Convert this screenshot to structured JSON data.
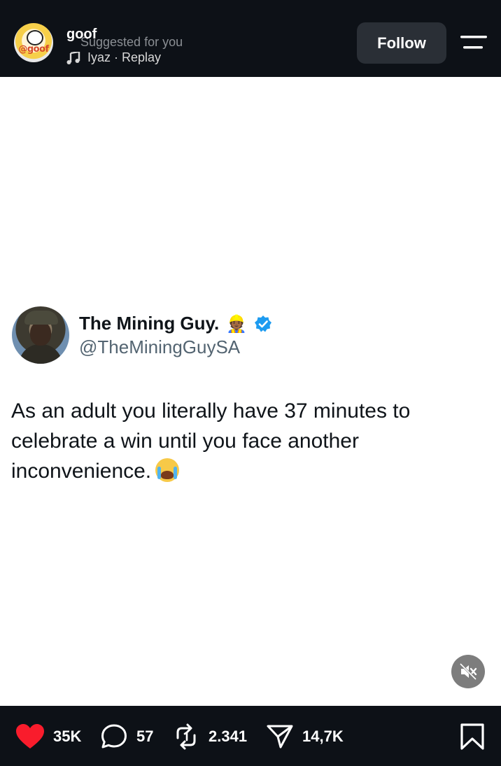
{
  "header": {
    "account_name": "goof",
    "subtitle": "Suggested for you",
    "music_label": "Iyaz · Replay",
    "follow_label": "Follow",
    "avatar_logo_text": "@goof"
  },
  "post": {
    "display_name": "The Mining Guy.",
    "name_emoji": "👷🏾",
    "handle": "@TheMiningGuySA",
    "text": "As an adult you literally have 37 minutes to celebrate a win until you face another inconvenience."
  },
  "actions": {
    "likes": "35K",
    "comments": "57",
    "reposts": "2.341",
    "shares": "14,7K"
  },
  "colors": {
    "bar_background": "#0d1117",
    "like_red": "#f91c2c",
    "verified_blue": "#1d9bf0",
    "follow_button": "#2a2f36"
  },
  "icons": [
    "music-note-icon",
    "menu-icon",
    "verified-badge-icon",
    "mute-icon",
    "heart-icon",
    "comment-icon",
    "repost-icon",
    "share-icon",
    "bookmark-icon"
  ]
}
